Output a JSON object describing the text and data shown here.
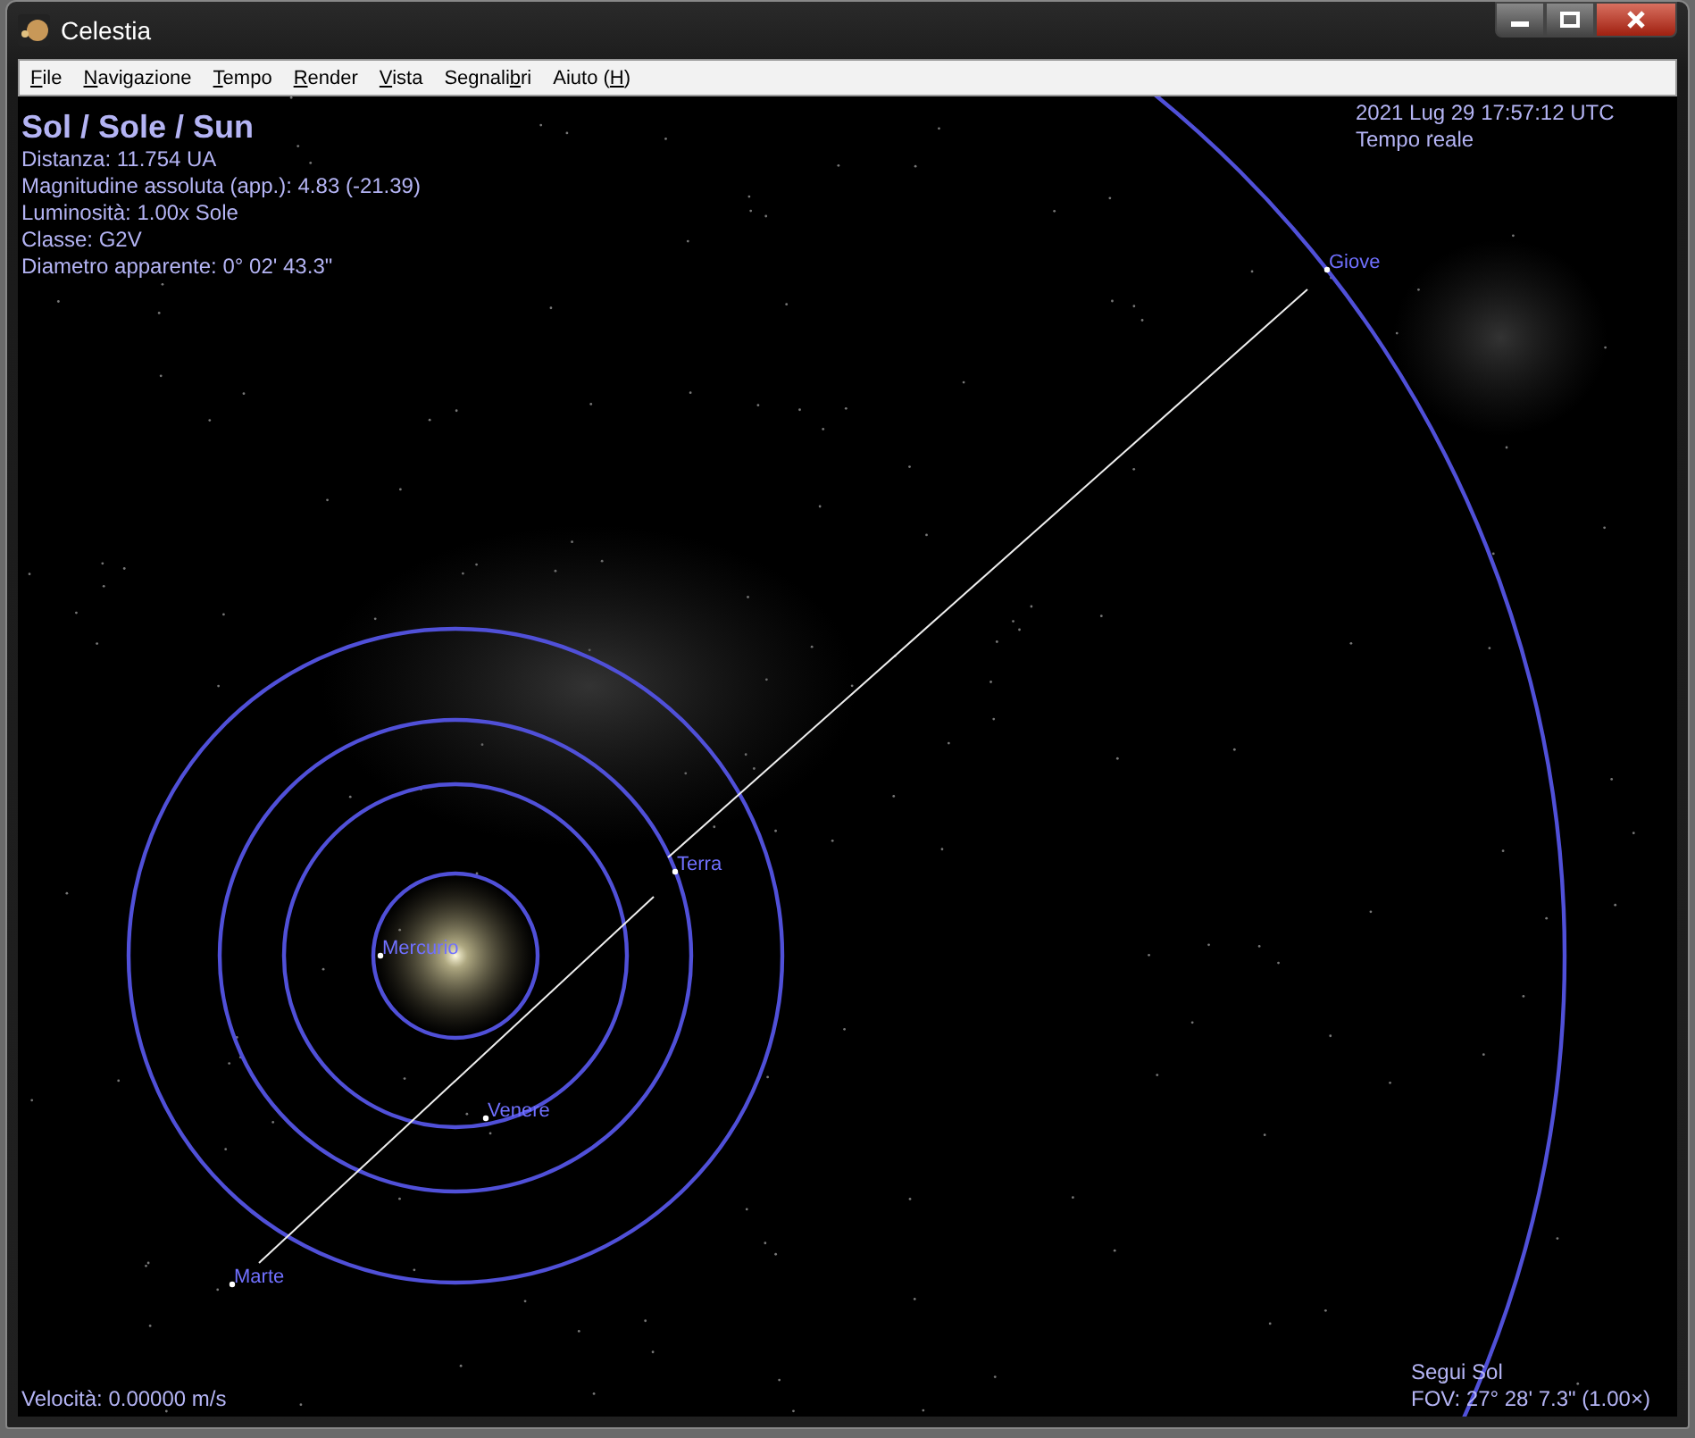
{
  "window": {
    "title": "Celestia"
  },
  "menu": [
    {
      "parts": [
        {
          "text": "F",
          "underlined": true
        },
        {
          "text": "ile",
          "underlined": false
        }
      ]
    },
    {
      "parts": [
        {
          "text": "N",
          "underlined": true
        },
        {
          "text": "avigazione",
          "underlined": false
        }
      ]
    },
    {
      "parts": [
        {
          "text": "T",
          "underlined": true
        },
        {
          "text": "empo",
          "underlined": false
        }
      ]
    },
    {
      "parts": [
        {
          "text": "R",
          "underlined": true
        },
        {
          "text": "ender",
          "underlined": false
        }
      ]
    },
    {
      "parts": [
        {
          "text": "V",
          "underlined": true
        },
        {
          "text": "ista",
          "underlined": false
        }
      ]
    },
    {
      "parts": [
        {
          "text": "Segnali",
          "underlined": false
        },
        {
          "text": "b",
          "underlined": true
        },
        {
          "text": "ri",
          "underlined": false
        }
      ]
    },
    {
      "parts": [
        {
          "text": "Aiuto (",
          "underlined": false
        },
        {
          "text": "H",
          "underlined": true
        },
        {
          "text": ")",
          "underlined": false
        }
      ]
    }
  ],
  "object_info": {
    "name": "Sol / Sole / Sun",
    "lines": [
      "Distanza: 11.754 UA",
      "Magnitudine assoluta (app.): 4.83 (-21.39)",
      "Luminosità: 1.00x Sole",
      "Classe: G2V",
      "Diametro apparente: 0° 02' 43.3\""
    ]
  },
  "time_info": {
    "date": "2021 Lug 29 17:57:12 UTC",
    "mode": "Tempo reale"
  },
  "planets": [
    {
      "name": "Mercurio"
    },
    {
      "name": "Venere"
    },
    {
      "name": "Terra"
    },
    {
      "name": "Marte"
    },
    {
      "name": "Giove"
    }
  ],
  "status": {
    "speed": "Velocità: 0.00000 m/s",
    "follow": "Segui Sol",
    "fov": "FOV: 27° 28' 7.3\" (1.00×)"
  }
}
